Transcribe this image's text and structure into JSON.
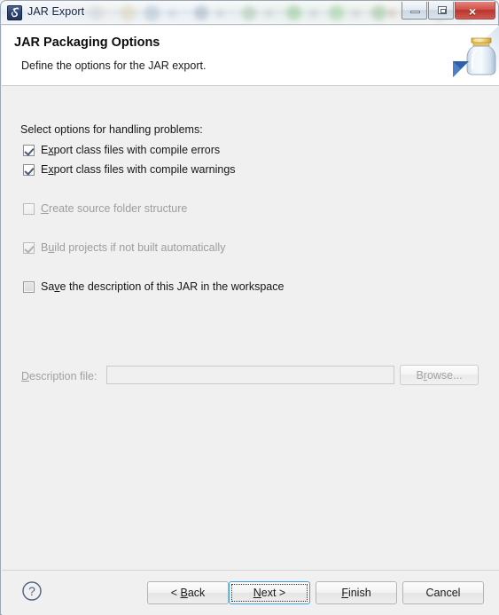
{
  "window": {
    "title": "JAR Export",
    "icon": "eclipse-jar-icon",
    "controls": {
      "minimize": "minimize-button",
      "maximize": "maximize-button",
      "close": "×"
    }
  },
  "header": {
    "title": "JAR Packaging Options",
    "description": "Define the options for the JAR export.",
    "art_icon": "jar-banner-icon"
  },
  "content": {
    "section_label": "Select options for handling problems:",
    "options": [
      {
        "label_pre": "E",
        "label_mnemonic": "x",
        "label_post": "port class files with compile errors",
        "full_label": "Export class files with compile errors",
        "checked": true,
        "enabled": true
      },
      {
        "label_pre": "E",
        "label_mnemonic": "x",
        "label_post": "port class files with compile warnings",
        "full_label": "Export class files with compile warnings",
        "checked": true,
        "enabled": true
      },
      {
        "label_pre": "",
        "label_mnemonic": "C",
        "label_post": "reate source folder structure",
        "full_label": "Create source folder structure",
        "checked": false,
        "enabled": false
      },
      {
        "label_pre": "B",
        "label_mnemonic": "u",
        "label_post": "ild projects if not built automatically",
        "full_label": "Build projects if not built automatically",
        "checked": true,
        "enabled": false
      },
      {
        "label_pre": "Sa",
        "label_mnemonic": "v",
        "label_post": "e the description of this JAR in the workspace",
        "full_label": "Save the description of this JAR in the workspace",
        "checked": false,
        "enabled": true
      }
    ],
    "description_file": {
      "label_mnemonic": "D",
      "label_post": "escription file:",
      "full_label": "Description file:",
      "value": "",
      "placeholder": "",
      "enabled": false
    },
    "browse_button": {
      "label_pre": "B",
      "label_mnemonic": "r",
      "label_post": "owse...",
      "full_label": "Browse...",
      "enabled": false
    }
  },
  "footer": {
    "help_icon": "help-question-icon",
    "buttons": [
      {
        "id": "back",
        "label_pre": "< ",
        "label_mnemonic": "B",
        "label_post": "ack",
        "full_label": "< Back",
        "focused": false
      },
      {
        "id": "next",
        "label_pre": "",
        "label_mnemonic": "N",
        "label_post": "ext >",
        "full_label": "Next >",
        "focused": true
      },
      {
        "id": "finish",
        "label_pre": "",
        "label_mnemonic": "F",
        "label_post": "inish",
        "full_label": "Finish",
        "focused": false
      },
      {
        "id": "cancel",
        "label_pre": "",
        "label_mnemonic": "",
        "label_post": "Cancel",
        "full_label": "Cancel",
        "focused": false
      }
    ]
  },
  "colors": {
    "dialog_background": "#f0f0f0",
    "header_background": "#ffffff",
    "focus_border": "#3c9cd8",
    "close_button": "#c1392f",
    "checkmark": "#4a5a78",
    "disabled_text": "#9d9d9d",
    "text": "#161616"
  }
}
